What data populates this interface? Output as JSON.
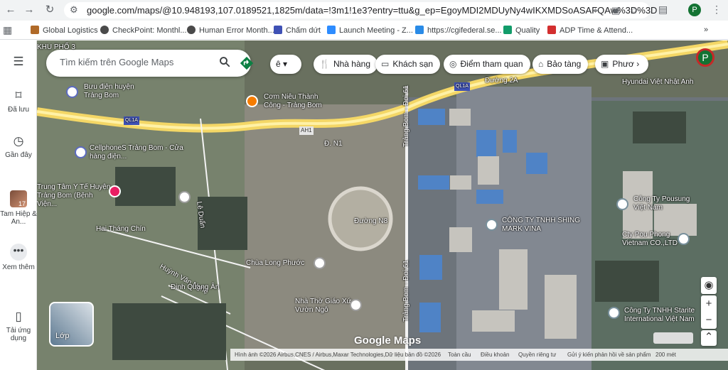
{
  "browser": {
    "url": "google.com/maps/@10.948193,107.0189521,1825m/data=!3m1!1e3?entry=ttu&g_ep=EgoyMDI2MDUyNy4wIKXMDSoASAFQAw%3D%3D",
    "profile_initial": "P",
    "bookmarks": [
      {
        "label": "Global Logistics",
        "color": "#b06a28"
      },
      {
        "label": "CheckPoint: Monthl...",
        "color": "#4a4a4a"
      },
      {
        "label": "Human Error Month...",
        "color": "#4a4a4a"
      },
      {
        "label": "Chấm dứt",
        "color": "#3f51b5"
      },
      {
        "label": "Launch Meeting - Z...",
        "color": "#2d8cff"
      },
      {
        "label": "https://cgifederal.se...",
        "color": "#2a8be7"
      },
      {
        "label": "Quality",
        "color": "#129c6a"
      },
      {
        "label": "ADP Time & Attend...",
        "color": "#d32f2f"
      }
    ]
  },
  "sidebar": {
    "menu_icon": "menu-icon",
    "items": [
      {
        "label": "Đã lưu",
        "icon": "bookmark-icon"
      },
      {
        "label": "Gần đây",
        "icon": "history-icon"
      },
      {
        "label": "Tam Hiệp & An...",
        "icon": "recent-place-thumbnail",
        "badge": "17"
      },
      {
        "label": "Xem thêm",
        "icon": "more-icon"
      },
      {
        "label": "Tải ứng dụng",
        "icon": "phone-icon"
      }
    ]
  },
  "search": {
    "placeholder": "Tìm kiếm trên Google Maps",
    "visible_partial": "ê"
  },
  "chips": [
    {
      "label": "Nhà hàng",
      "icon": "restaurant-icon"
    },
    {
      "label": "Khách sạn",
      "icon": "hotel-icon"
    },
    {
      "label": "Điểm tham quan",
      "icon": "camera-icon"
    },
    {
      "label": "Bảo tàng",
      "icon": "museum-icon"
    },
    {
      "label": "Phươ",
      "icon": "transit-icon"
    }
  ],
  "map_labels": [
    "KHU PHỐ 3",
    "Bưu điện huyện Trảng Bom",
    "Cơm Niêu Thành Công - Trảng Bom",
    "QL1A",
    "CellphoneS Trảng Bom - Cửa hàng điện...",
    "Trung Tâm Y Tế Huyện Trảng Bom (Bệnh Viện...",
    "Đ. N1",
    "AH1",
    "Trảng Bom - Đoi 61",
    "QL1A",
    "Đường 2A",
    "Hyundai Việt Nhật Anh",
    "Đường N8",
    "Lê Duẩn",
    "Hai Tháng Chín",
    "Chùa Long Phước",
    "Huỳnh Văn Nghệ",
    "Đinh Quang Ân",
    "Nhà Thờ Giáo Xứ Vườn Ngô",
    "CÔNG TY TNHH SHING MARK VINA",
    "Công Ty Pousung Việt Nam",
    "Cty Pou Phong Vietnam CO.,LTD",
    "Công Ty TNHH Starite International Việt Nam",
    "Trảng Bom - Đoi 61"
  ],
  "map_controls": {
    "layers": "Lớp",
    "footer": [
      "Hình ảnh ©2026 Airbus,CNES / Airbus,Maxar Technologies,Dữ liệu bản đồ ©2026",
      "Toàn cầu",
      "Điều khoản",
      "Quyền riêng tư",
      "Gửi ý kiến phản hồi về sản phẩm",
      "200 mét"
    ],
    "logo": "Google Maps"
  }
}
